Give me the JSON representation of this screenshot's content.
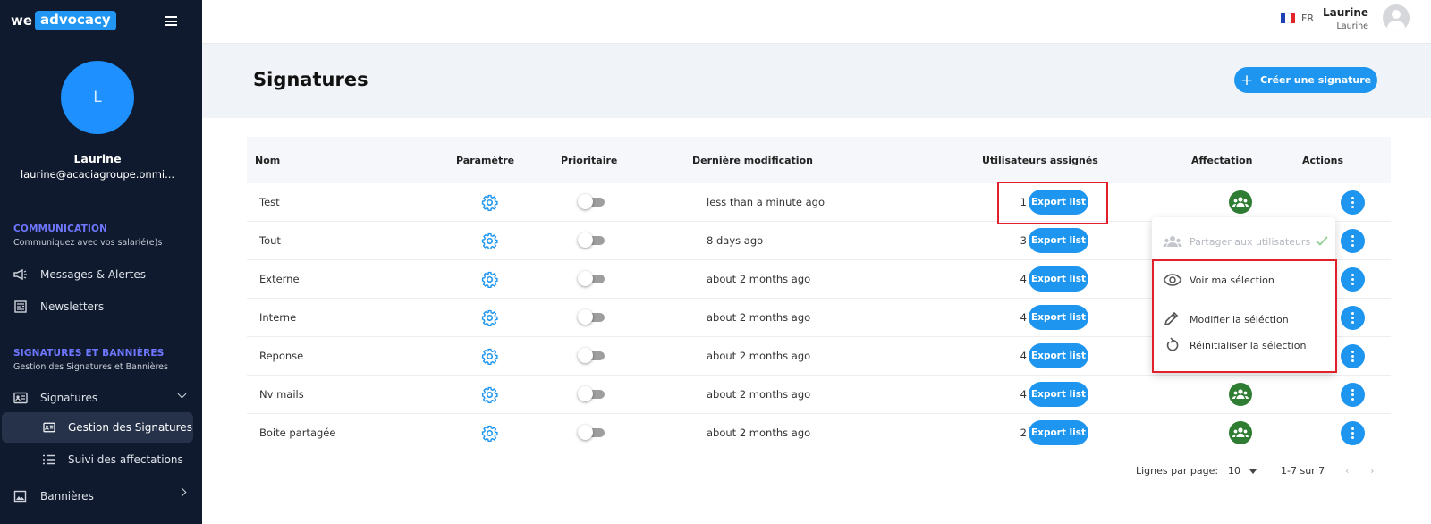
{
  "sidebar": {
    "logo_we": "we",
    "logo_box": "advocacy",
    "avatar_initial": "L",
    "user_name": "Laurine",
    "user_email": "laurine@acaciagroupe.onmi...",
    "sections": [
      {
        "title": "COMMUNICATION",
        "subtitle": "Communiquez avec vos salarié(e)s"
      },
      {
        "title": "SIGNATURES ET BANNIÈRES",
        "subtitle": "Gestion des Signatures et Bannières"
      }
    ],
    "items": {
      "messages": "Messages & Alertes",
      "newsletters": "Newsletters",
      "signatures": "Signatures",
      "gestion": "Gestion des Signatures",
      "suivi": "Suivi des affectations",
      "bannieres": "Bannières"
    }
  },
  "topbar": {
    "lang": "FR",
    "user_name": "Laurine",
    "user_sub": "Laurine"
  },
  "page": {
    "title": "Signatures",
    "create_button": "Créer une signature"
  },
  "table": {
    "headers": {
      "nom": "Nom",
      "parametre": "Paramètre",
      "prioritaire": "Prioritaire",
      "modification": "Dernière modification",
      "utilisateurs": "Utilisateurs assignés",
      "affectation": "Affectation",
      "actions": "Actions"
    },
    "export_label": "Export list",
    "rows": [
      {
        "name": "Test",
        "modified": "less than a minute ago",
        "count": "1"
      },
      {
        "name": "Tout",
        "modified": "8 days ago",
        "count": "3"
      },
      {
        "name": "Externe",
        "modified": "about 2 months ago",
        "count": "4"
      },
      {
        "name": "Interne",
        "modified": "about 2 months ago",
        "count": "4"
      },
      {
        "name": "Reponse",
        "modified": "about 2 months ago",
        "count": "4"
      },
      {
        "name": "Nv mails",
        "modified": "about 2 months ago",
        "count": "4"
      },
      {
        "name": "Boite partagée",
        "modified": "about 2 months ago",
        "count": "2"
      }
    ]
  },
  "pagination": {
    "label": "Lignes par page:",
    "per_page": "10",
    "range": "1-7 sur 7"
  },
  "menu": {
    "share": "Partager aux utilisateurs",
    "view": "Voir ma sélection",
    "edit": "Modifier la séléction",
    "reset": "Réinitialiser la sélection"
  },
  "colors": {
    "sidebar_bg": "#0f1a2e",
    "accent_blue": "#1e96f0",
    "affect_green": "#2e7d32",
    "section_purple": "#6f77ff",
    "highlight_red": "#e0202a"
  }
}
